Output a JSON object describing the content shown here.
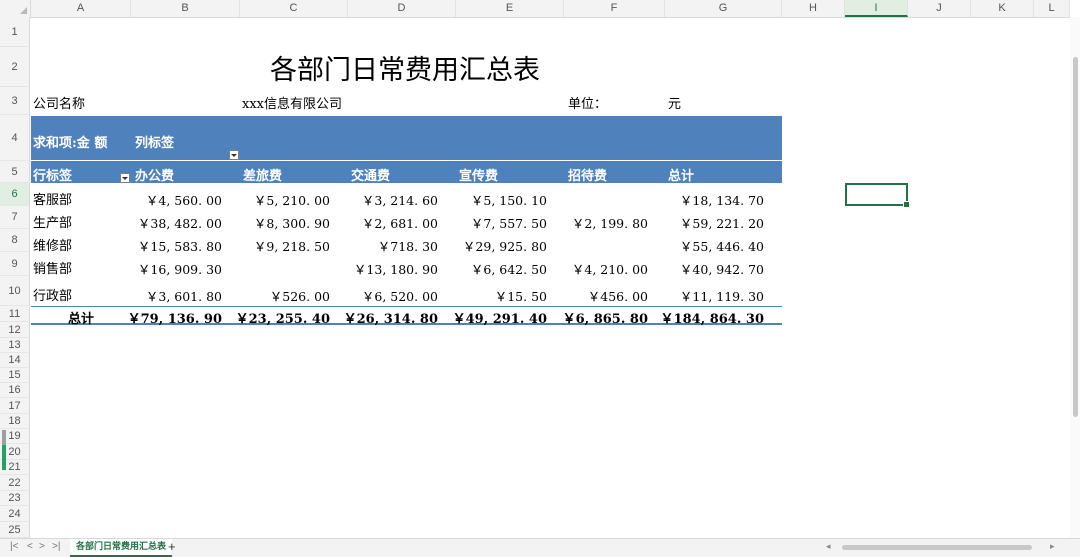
{
  "columns": [
    "A",
    "B",
    "C",
    "D",
    "E",
    "F",
    "G",
    "H",
    "I",
    "J",
    "K",
    "L"
  ],
  "rows": [
    "1",
    "2",
    "3",
    "4",
    "5",
    "6",
    "7",
    "8",
    "9",
    "10",
    "11",
    "12",
    "13",
    "14",
    "15",
    "16",
    "17",
    "18",
    "19",
    "20",
    "21",
    "22",
    "23",
    "24",
    "25"
  ],
  "selected_column": "I",
  "selected_row": "6",
  "title": "各部门日常费用汇总表",
  "info": {
    "company_label": "公司名称",
    "company_value": "xxx信息有限公司",
    "unit_label": "单位：",
    "unit_value": "元"
  },
  "pivot": {
    "sum_label": "求和项:金 额",
    "col_label": "列标签",
    "row_label": "行标签",
    "headers": [
      "办公费",
      "差旅费",
      "交通费",
      "宣传费",
      "招待费",
      "总计"
    ],
    "rows": [
      {
        "name": "客服部",
        "values": [
          "￥4, 560. 00",
          "￥5, 210. 00",
          "￥3, 214. 60",
          "￥5, 150. 10",
          "",
          "￥18, 134. 70"
        ]
      },
      {
        "name": "生产部",
        "values": [
          "￥38, 482. 00",
          "￥8, 300. 90",
          "￥2, 681. 00",
          "￥7, 557. 50",
          "￥2, 199. 80",
          "￥59, 221. 20"
        ]
      },
      {
        "name": "维修部",
        "values": [
          "￥15, 583. 80",
          "￥9, 218. 50",
          "￥718. 30",
          "￥29, 925. 80",
          "",
          "￥55, 446. 40"
        ]
      },
      {
        "name": "销售部",
        "values": [
          "￥16, 909. 30",
          "",
          "￥13, 180. 90",
          "￥6, 642. 50",
          "￥4, 210. 00",
          "￥40, 942. 70"
        ]
      },
      {
        "name": "行政部",
        "values": [
          "￥3, 601. 80",
          "￥526. 00",
          "￥6, 520. 00",
          "￥15. 50",
          "￥456. 00",
          "￥11, 119. 30"
        ]
      }
    ],
    "total_label": "总计",
    "totals": [
      "￥79, 136. 90",
      "￥23, 255. 40",
      "￥26, 314. 80",
      "￥49, 291. 40",
      "￥6, 865. 80",
      "￥184, 864. 30"
    ]
  },
  "sheet_tab": "各部门日常费用汇总表",
  "add_tab": "+",
  "nav": [
    "|<",
    "<",
    ">",
    ">|"
  ],
  "colors": {
    "band": "#4f81bd",
    "accent": "#217346"
  }
}
